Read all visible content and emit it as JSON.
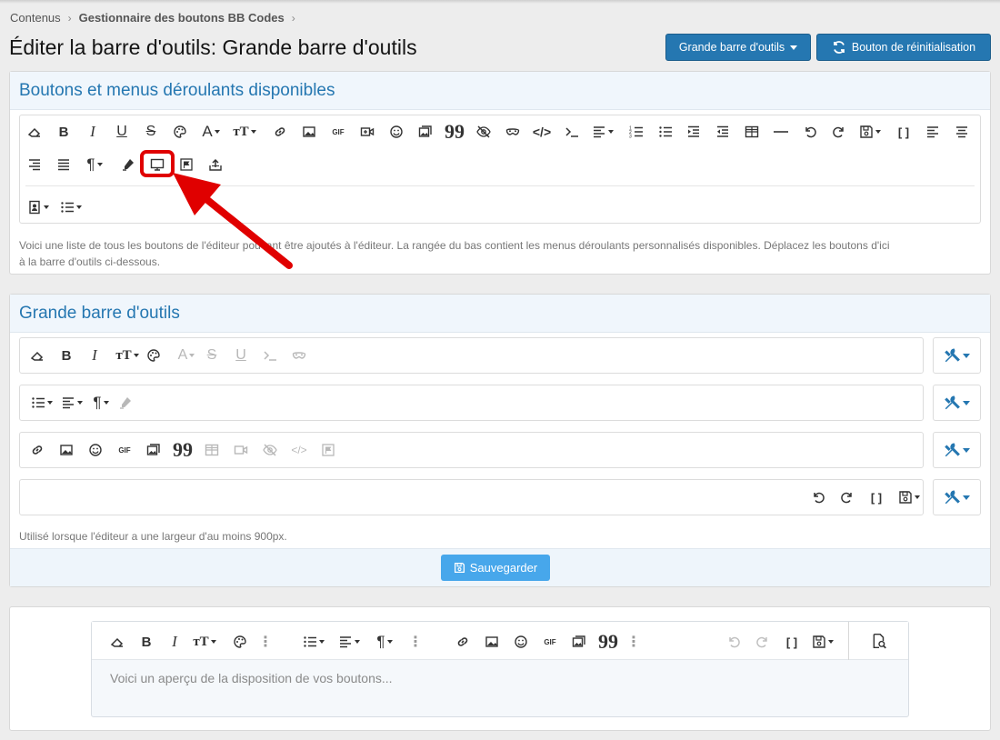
{
  "breadcrumb": {
    "items": [
      "Contenus",
      "Gestionnaire des boutons BB Codes"
    ]
  },
  "page": {
    "title": "Éditer la barre d'outils: Grande barre d'outils"
  },
  "header_buttons": {
    "toolbar_select": "Grande barre d'outils",
    "reset": "Bouton de réinitialisation"
  },
  "available": {
    "title": "Boutons et menus déroulants disponibles",
    "description_line1": "Voici une liste de tous les boutons de l'éditeur pouvant être ajoutés à l'éditeur. La rangée du bas contient les menus déroulants personnalisés disponibles. Déplacez les boutons d'ici",
    "description_line2": "à la barre d'outils ci-dessous."
  },
  "large_toolbar": {
    "title": "Grande barre d'outils",
    "description": "Utilisé lorsque l'éditeur a une largeur d'au moins 900px.",
    "save_label": "Sauvegarder"
  },
  "preview": {
    "placeholder": "Voici un aperçu de la disposition de vos boutons..."
  },
  "colors": {
    "accent": "#2577b1",
    "save": "#47a7eb",
    "highlight": "#e00000"
  }
}
